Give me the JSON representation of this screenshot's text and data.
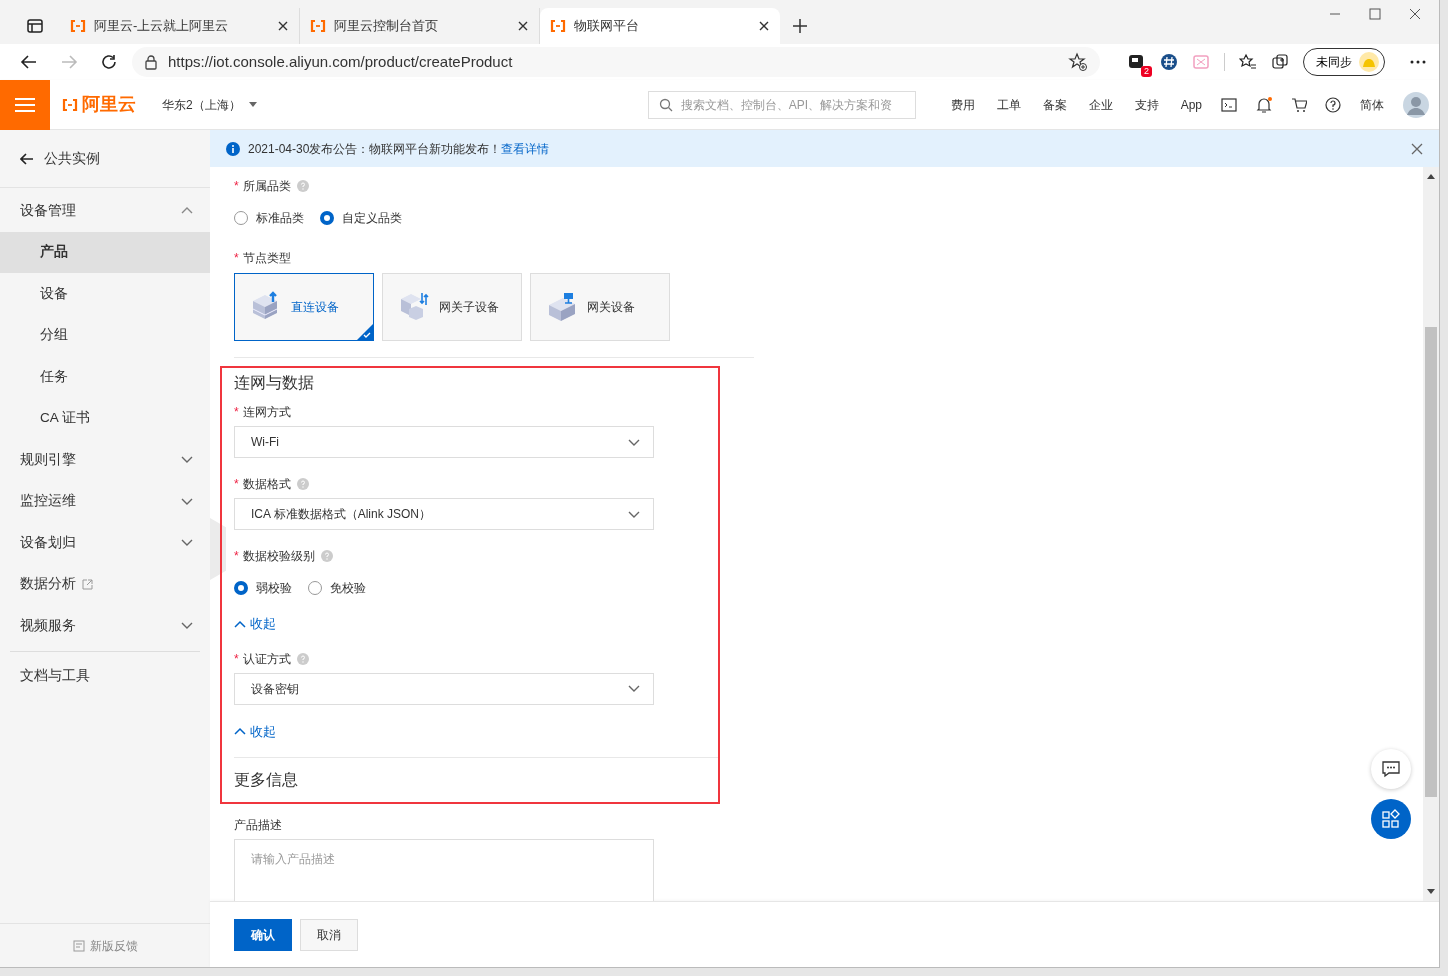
{
  "browser": {
    "tabs": [
      {
        "title": "阿里云-上云就上阿里云",
        "selected": false
      },
      {
        "title": "阿里云控制台首页",
        "selected": false
      },
      {
        "title": "物联网平台",
        "selected": true
      }
    ],
    "url": "https://iot.console.aliyun.com/product/createProduct",
    "extension_badge": "2",
    "sync_label": "未同步"
  },
  "header": {
    "logo": "阿里云",
    "region": "华东2（上海）",
    "search_placeholder": "搜索文档、控制台、API、解决方案和资",
    "links": [
      "费用",
      "工单",
      "备案",
      "企业",
      "支持",
      "App"
    ],
    "language": "简体"
  },
  "sidebar": {
    "back": "公共实例",
    "items": [
      {
        "kind": "group",
        "label": "设备管理",
        "expanded": true,
        "children": [
          {
            "label": "产品",
            "selected": true
          },
          {
            "label": "设备",
            "selected": false
          },
          {
            "label": "分组",
            "selected": false
          },
          {
            "label": "任务",
            "selected": false
          },
          {
            "label": "CA 证书",
            "selected": false
          }
        ]
      },
      {
        "kind": "group",
        "label": "规则引擎",
        "expanded": false
      },
      {
        "kind": "group",
        "label": "监控运维",
        "expanded": false
      },
      {
        "kind": "group",
        "label": "设备划归",
        "expanded": false
      },
      {
        "kind": "external",
        "label": "数据分析"
      },
      {
        "kind": "group",
        "label": "视频服务",
        "expanded": false
      },
      {
        "kind": "divider"
      },
      {
        "kind": "link",
        "label": "文档与工具"
      }
    ],
    "feedback": "新版反馈"
  },
  "notice": {
    "text": "2021-04-30发布公告：物联网平台新功能发布！",
    "link": "查看详情"
  },
  "form": {
    "required_symbol": "*",
    "fields": [
      {
        "kind": "radio",
        "label": "所属品类",
        "required": true,
        "help": true,
        "options": [
          {
            "label": "标准品类",
            "selected": false
          },
          {
            "label": "自定义品类",
            "selected": true
          }
        ]
      },
      {
        "kind": "tiles",
        "label": "节点类型",
        "required": true,
        "help": false,
        "options": [
          {
            "label": "直连设备",
            "selected": true
          },
          {
            "label": "网关子设备",
            "selected": false
          },
          {
            "label": "网关设备",
            "selected": false
          }
        ]
      },
      {
        "kind": "divider"
      }
    ],
    "highlighted_fields": [
      {
        "kind": "heading",
        "label": "连网与数据"
      },
      {
        "kind": "select",
        "label": "连网方式",
        "required": true,
        "help": false,
        "value": "Wi-Fi"
      },
      {
        "kind": "select",
        "label": "数据格式",
        "required": true,
        "help": true,
        "value": "ICA 标准数据格式（Alink JSON）"
      },
      {
        "kind": "radio",
        "label": "数据校验级别",
        "required": true,
        "help": true,
        "options": [
          {
            "label": "弱校验",
            "selected": true
          },
          {
            "label": "免校验",
            "selected": false
          }
        ]
      },
      {
        "kind": "collapse",
        "label": "收起"
      },
      {
        "kind": "select",
        "label": "认证方式",
        "required": true,
        "help": true,
        "value": "设备密钥"
      },
      {
        "kind": "collapse",
        "label": "收起"
      },
      {
        "kind": "divider"
      },
      {
        "kind": "heading",
        "label": "更多信息"
      }
    ],
    "more_fields": [
      {
        "kind": "textarea",
        "label": "产品描述",
        "required": false,
        "help": false,
        "placeholder": "请输入产品描述"
      }
    ],
    "buttons": [
      {
        "label": "确认",
        "primary": true
      },
      {
        "label": "取消",
        "primary": false
      }
    ]
  }
}
